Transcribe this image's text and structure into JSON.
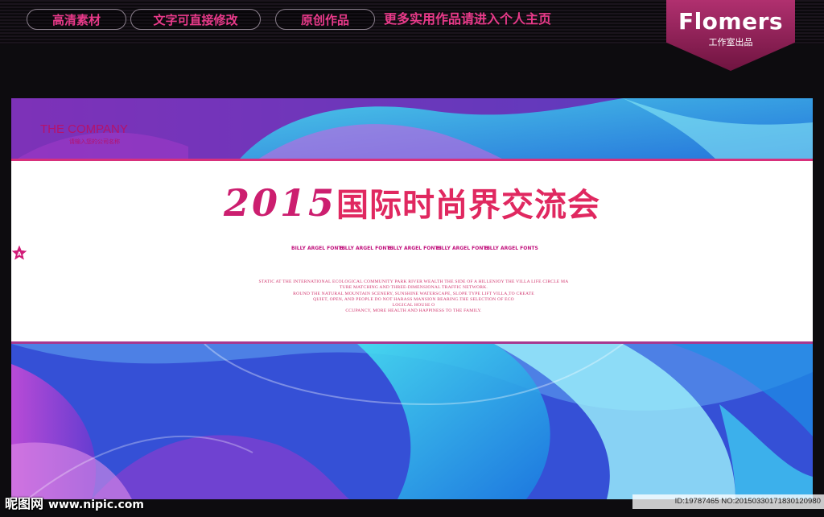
{
  "header": {
    "tags": [
      "高清素材",
      "文字可直接修改",
      "原创作品"
    ],
    "promo": "更多实用作品请进入个人主页",
    "brand_name": "Flomers",
    "brand_sub": "工作室出品"
  },
  "banner": {
    "company": "THE COMPANY",
    "company_sub": "请输入您的公司名称",
    "year": "2015",
    "title": "国际时尚界交流会",
    "logos": [
      {
        "letter": "A",
        "name": "BILLY ARGEL FONTS"
      },
      {
        "letter": "A",
        "name": "BILLY ARGEL FONTS"
      },
      {
        "letter": "A",
        "name": "BILLY ARGEL FONTS"
      },
      {
        "letter": "A",
        "name": "BILLY ARGEL FONTS"
      },
      {
        "letter": "A",
        "name": "BILLY ARGEL FONTS"
      }
    ],
    "paragraph_lines": [
      "STATIC AT THE INTERNATIONAL ECOLOGICAL COMMUNITY PARK RIVER WEALTH THE SIDE OF A HILLENJOY THE VILLA LIFE CIRCLE MA",
      "TURE MATCHING AND THREE-DIMENSIONAL TRAFFIC NETWORK.",
      "ROUND THE NATURAL MOUNTAIN SCENERY, SUNSHINE WATERSCAPE, SLOPE TYPE LIFT VILLA,TO CREATE",
      "QUIET, OPEN, AND PEOPLE DO NOT HARASS MANSION BEARING.THE SELECTION OF ECO",
      "LOGICAL HOUSE O",
      "CCUPANCY, MORE HEALTH AND HAPPINESS TO THE FAMILY."
    ]
  },
  "footer": {
    "site_name": "昵图网",
    "site_url": "www.nipic.com",
    "image_id": "ID:19787465 NO:20150330171830120980"
  },
  "colors": {
    "accent_pink": "#e93a8a",
    "headline_red": "#e02860",
    "brand_bg": "#9b2560"
  }
}
